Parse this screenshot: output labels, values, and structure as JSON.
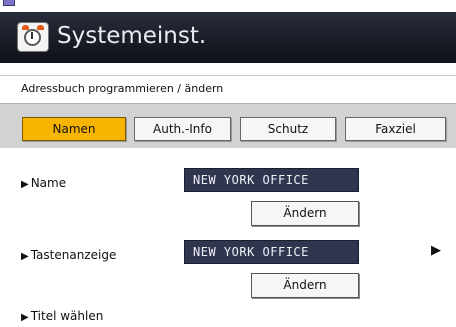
{
  "window": {
    "title": "Systemeinst."
  },
  "breadcrumb": "Adressbuch programmieren / ändern",
  "tabs": [
    {
      "label": "Namen",
      "active": true
    },
    {
      "label": "Auth.-Info",
      "active": false
    },
    {
      "label": "Schutz",
      "active": false
    },
    {
      "label": "Faxziel",
      "active": false
    }
  ],
  "fields": {
    "name": {
      "label": "Name",
      "value": "NEW YORK OFFICE",
      "button": "Ändern"
    },
    "key_display": {
      "label": "Tastenanzeige",
      "value": "NEW YORK OFFICE",
      "button": "Ändern"
    },
    "select_title": {
      "label": "Titel wählen"
    }
  },
  "icons": {
    "app": "alarm-clock-settings-icon",
    "row_marker": "triangle-right-icon",
    "next": "triangle-right-icon"
  },
  "colors": {
    "titlebar": "#1a1c27",
    "active_tab": "#f7b400",
    "value_field": "#303650",
    "tabbar": "#d2d2d2"
  }
}
